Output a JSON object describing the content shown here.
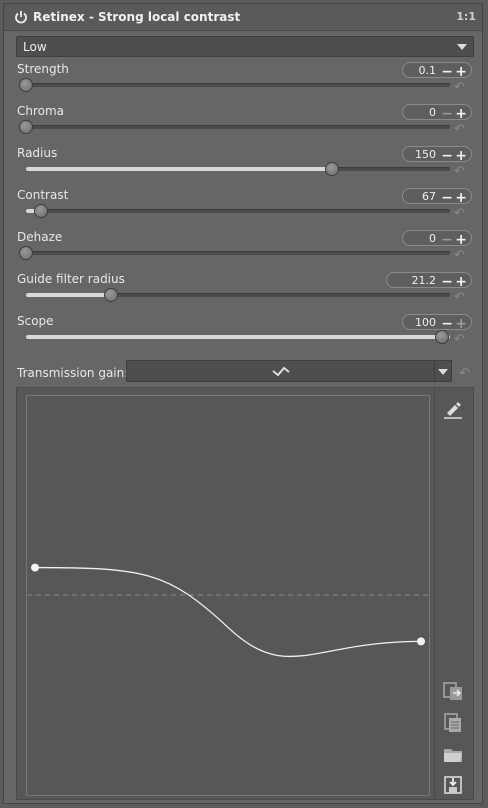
{
  "module": {
    "title": "Retinex - Strong local contrast",
    "ratio": "1:1",
    "icons": {
      "power": "power-icon"
    }
  },
  "method_combo": {
    "value": "Low"
  },
  "sliders": [
    {
      "label": "Strength",
      "value": "0.1",
      "fraction": 0.0,
      "min_enabled": true,
      "max_enabled": true
    },
    {
      "label": "Chroma",
      "value": "0",
      "fraction": 0.0,
      "min_enabled": false,
      "max_enabled": true
    },
    {
      "label": "Radius",
      "value": "150",
      "fraction": 0.735,
      "min_enabled": true,
      "max_enabled": true
    },
    {
      "label": "Contrast",
      "value": "67",
      "fraction": 0.035,
      "min_enabled": true,
      "max_enabled": true
    },
    {
      "label": "Dehaze",
      "value": "0",
      "fraction": 0.0,
      "min_enabled": false,
      "max_enabled": true
    },
    {
      "label": "Guide filter radius",
      "value": "21.2",
      "fraction": 0.205,
      "min_enabled": true,
      "max_enabled": true
    },
    {
      "label": "Scope",
      "value": "100",
      "fraction": 1.0,
      "min_enabled": true,
      "max_enabled": false
    }
  ],
  "transmission": {
    "label": "Transmission gain:",
    "preset_icon": "curve-type-icon",
    "curve_points": [
      [
        0.0,
        0.57
      ],
      [
        0.5,
        0.42
      ],
      [
        1.0,
        0.385
      ]
    ]
  },
  "colors": {
    "panel_bg": "#666666",
    "curve_bg": "#575757",
    "curve_line": "#f0f0f0"
  },
  "side_tools": [
    "edit-points-icon",
    "copy-curve-icon",
    "paste-curve-icon",
    "open-curve-icon",
    "save-curve-icon"
  ]
}
